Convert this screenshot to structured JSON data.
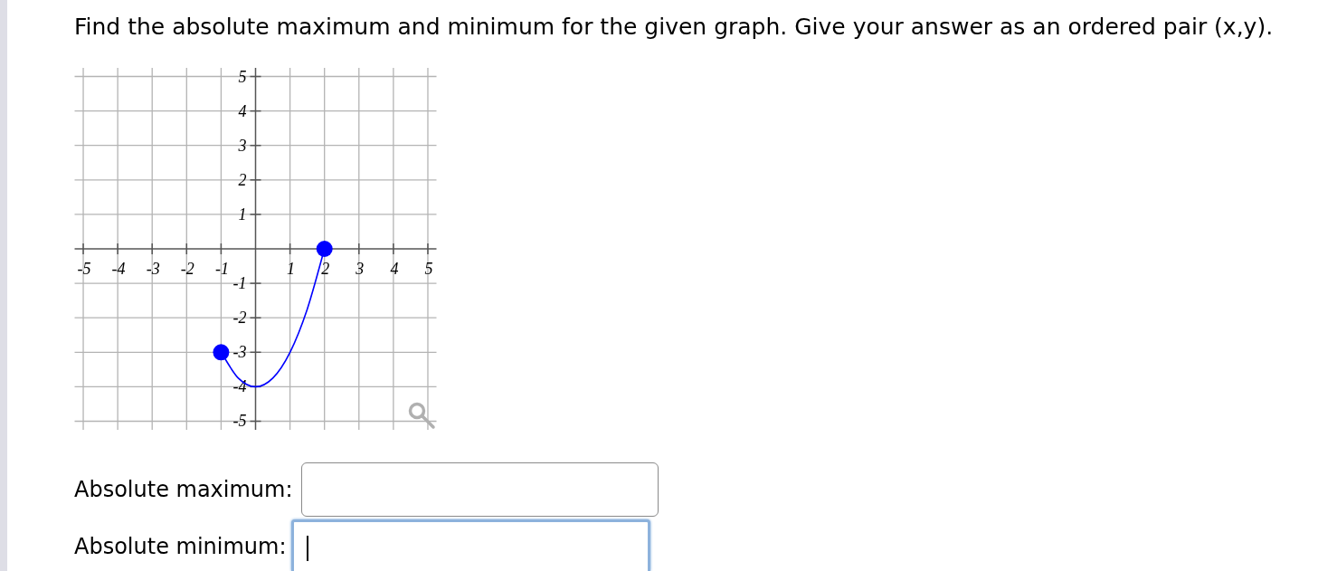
{
  "question": {
    "text": "Find the absolute maximum and minimum for the given graph. Give your answer as an ordered pair (x,y)."
  },
  "graph": {
    "chart_data": {
      "type": "line",
      "x": [
        -1,
        -0.5,
        0,
        0.5,
        1,
        1.5,
        2
      ],
      "series": [
        {
          "color": "#0000ff",
          "values": [
            -3,
            -3.75,
            -4,
            -3.75,
            -3,
            -1.75,
            0
          ]
        },
        {
          "type": "scatter",
          "color": "#0000ff",
          "values": [
            -3,
            null,
            null,
            null,
            null,
            null,
            0
          ]
        }
      ],
      "xlim": [
        -5.25,
        5.25
      ],
      "ylim": [
        -5.25,
        5.25
      ],
      "xticks": [
        -5,
        -4,
        -3,
        -2,
        -1,
        1,
        2,
        3,
        4,
        5
      ],
      "yticks": [
        -5,
        -4,
        -3,
        -2,
        -1,
        1,
        2,
        3,
        4,
        5
      ],
      "grid": true
    }
  },
  "answers": [
    {
      "label": "Absolute maximum:",
      "focused": false
    },
    {
      "label": "Absolute minimum:",
      "focused": true
    }
  ]
}
